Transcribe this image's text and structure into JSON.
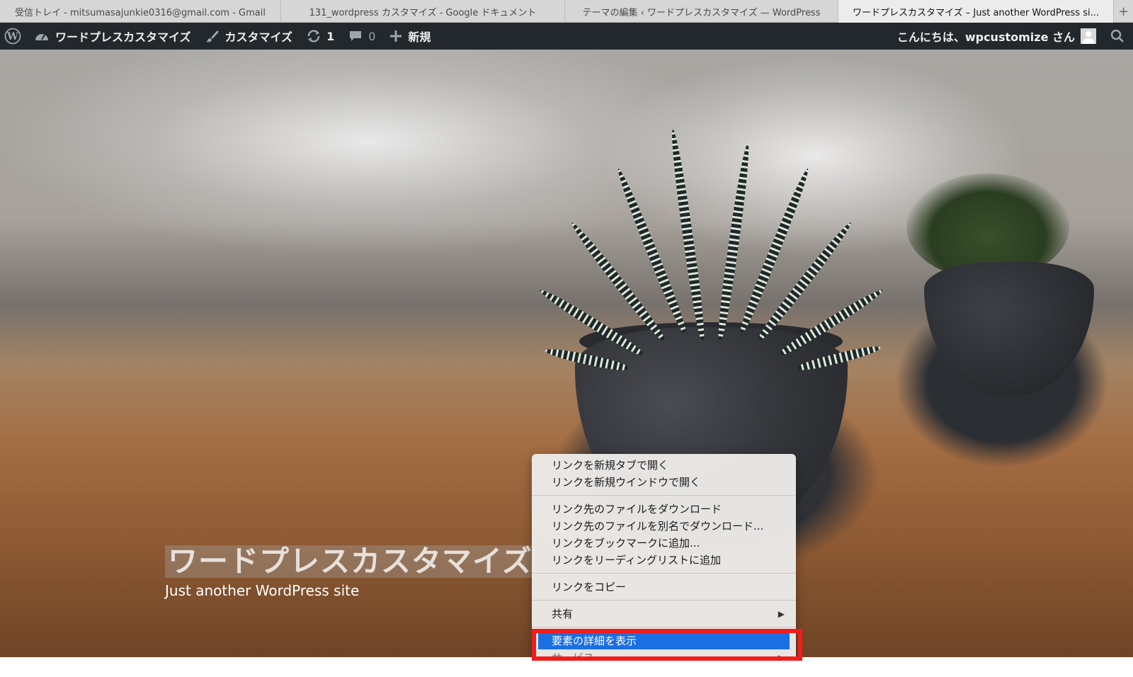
{
  "tabs": [
    {
      "label": "受信トレイ - mitsumasajunkie0316@gmail.com - Gmail",
      "active": false
    },
    {
      "label": "131_wordpress カスタマイズ - Google ドキュメント",
      "active": false
    },
    {
      "label": "テーマの編集 ‹ ワードプレスカスタマイズ — WordPress",
      "active": false
    },
    {
      "label": "ワードプレスカスタマイズ – Just another WordPress si...",
      "active": true
    }
  ],
  "new_tab_label": "+",
  "admin_bar": {
    "site_name": "ワードプレスカスタマイズ",
    "customize": "カスタマイズ",
    "updates_count": "1",
    "comments_count": "0",
    "new_label": "新規",
    "greeting": "こんにちは、wpcustomize さん"
  },
  "hero": {
    "site_title": "ワードプレスカスタマイズ",
    "tagline": "Just another WordPress site"
  },
  "context_menu": {
    "group1": [
      "リンクを新規タブで開く",
      "リンクを新規ウインドウで開く"
    ],
    "group2": [
      "リンク先のファイルをダウンロード",
      "リンク先のファイルを別名でダウンロード...",
      "リンクをブックマークに追加...",
      "リンクをリーディングリストに追加"
    ],
    "group3": [
      "リンクをコピー"
    ],
    "share": "共有",
    "inspect": "要素の詳細を表示",
    "services": "サービス"
  },
  "colors": {
    "admin_bar_bg": "#23282d",
    "highlight_blue": "#1a6fe3",
    "annotation_red": "#f21c1c"
  }
}
